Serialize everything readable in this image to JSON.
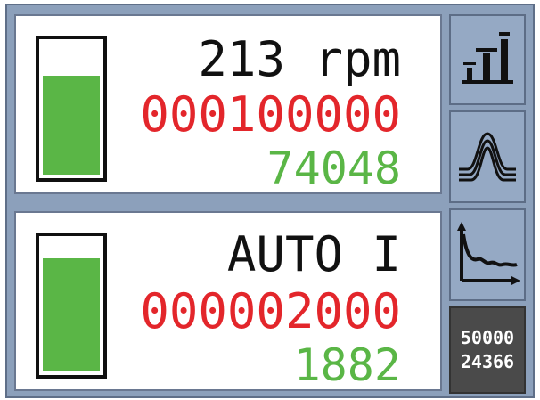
{
  "panels": [
    {
      "label": "213 rpm",
      "counter": "000100000",
      "value": "74048",
      "bar_level": 0.75,
      "colors": {
        "label": "#111111",
        "counter": "#e3262b",
        "value": "#5ab646",
        "bar": "#5ab646"
      }
    },
    {
      "label": "AUTO I",
      "counter": "000002000",
      "value": "1882",
      "bar_level": 0.86,
      "colors": {
        "label": "#111111",
        "counter": "#e3262b",
        "value": "#5ab646",
        "bar": "#5ab646"
      }
    }
  ],
  "side_buttons": [
    {
      "icon": "bar-levels-icon"
    },
    {
      "icon": "waveform-peaks-icon"
    },
    {
      "icon": "decay-graph-icon"
    },
    {
      "line1": "50000",
      "line2": "24366"
    }
  ],
  "colors": {
    "background": "#8ca0bb",
    "button": "#95a9c4",
    "status_button": "#4a4a4a"
  }
}
